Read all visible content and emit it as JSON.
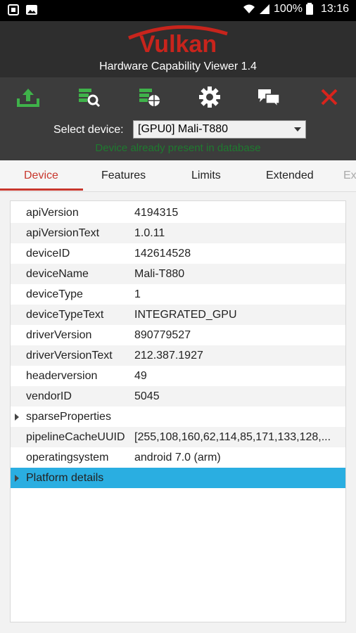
{
  "status_bar": {
    "battery": "100%",
    "time": "13:16"
  },
  "header": {
    "logo_text": "Vulkan",
    "title": "Hardware Capability Viewer 1.4"
  },
  "toolbar": {
    "buttons": [
      {
        "icon": "upload-icon"
      },
      {
        "icon": "search-database-icon"
      },
      {
        "icon": "database-web-icon"
      },
      {
        "icon": "gear-icon"
      },
      {
        "icon": "chat-icon"
      },
      {
        "icon": "close-icon"
      }
    ],
    "colors": {
      "upload": "#3fb24a",
      "close": "#d9241c"
    }
  },
  "device_select": {
    "label": "Select device:",
    "value": "[GPU0] Mali-T880",
    "status": "Device already present in database"
  },
  "tabs": [
    {
      "label": "Device",
      "active": true
    },
    {
      "label": "Features",
      "active": false
    },
    {
      "label": "Limits",
      "active": false
    },
    {
      "label": "Extended",
      "active": false
    },
    {
      "label": "Ex",
      "active": false
    }
  ],
  "properties": [
    {
      "key": "apiVersion",
      "value": "4194315"
    },
    {
      "key": "apiVersionText",
      "value": "1.0.11"
    },
    {
      "key": "deviceID",
      "value": "142614528"
    },
    {
      "key": "deviceName",
      "value": "Mali-T880"
    },
    {
      "key": "deviceType",
      "value": "1"
    },
    {
      "key": "deviceTypeText",
      "value": "INTEGRATED_GPU"
    },
    {
      "key": "driverVersion",
      "value": "890779527"
    },
    {
      "key": "driverVersionText",
      "value": "212.387.1927"
    },
    {
      "key": "headerversion",
      "value": "49"
    },
    {
      "key": "vendorID",
      "value": "5045"
    },
    {
      "key": "sparseProperties",
      "value": ""
    },
    {
      "key": "pipelineCacheUUID",
      "value": "[255,108,160,62,114,85,171,133,128,..."
    },
    {
      "key": "operatingsystem",
      "value": "android 7.0 (arm)"
    },
    {
      "key": "Platform details",
      "value": ""
    }
  ]
}
